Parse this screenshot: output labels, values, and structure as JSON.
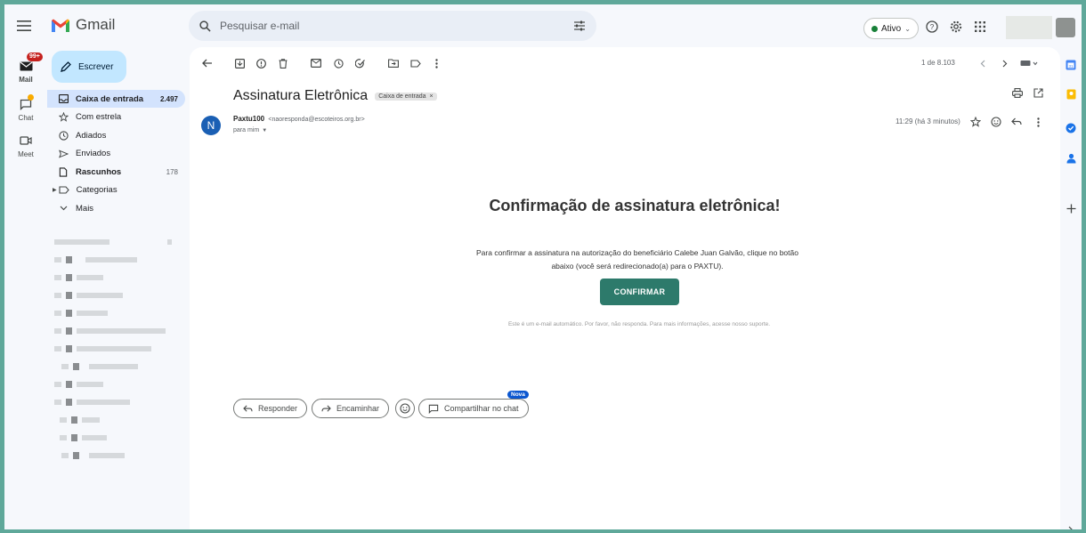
{
  "app": {
    "name": "Gmail"
  },
  "search": {
    "placeholder": "Pesquisar e-mail"
  },
  "status": {
    "label": "Ativo",
    "color": "#188038"
  },
  "rail": {
    "mail": {
      "label": "Mail",
      "badge": "99+"
    },
    "chat": {
      "label": "Chat"
    },
    "meet": {
      "label": "Meet"
    }
  },
  "compose": {
    "label": "Escrever"
  },
  "nav": [
    {
      "label": "Caixa de entrada",
      "count": "2.497",
      "icon": "inbox-icon"
    },
    {
      "label": "Com estrela",
      "count": "",
      "icon": "star-icon"
    },
    {
      "label": "Adiados",
      "count": "",
      "icon": "clock-icon"
    },
    {
      "label": "Enviados",
      "count": "",
      "icon": "send-icon"
    },
    {
      "label": "Rascunhos",
      "count": "178",
      "icon": "draft-icon"
    },
    {
      "label": "Categorias",
      "count": "",
      "icon": "label-icon"
    },
    {
      "label": "Mais",
      "count": "",
      "icon": "chevron-down-icon"
    }
  ],
  "toolbar": {
    "pager": "1 de 8.103"
  },
  "email": {
    "subject": "Assinatura Eletrônica",
    "label_chip": "Caixa de entrada",
    "label_close": "×",
    "avatar_letter": "N",
    "sender_name": "Paxtu100",
    "sender_email": "<naoresponda@escoteiros.org.br>",
    "to": "para mim",
    "time": "11:29 (há 3 minutos)",
    "body": {
      "heading": "Confirmação de assinatura eletrônica!",
      "text_line1": "Para confirmar a assinatura na autorização do beneficiário Calebe Juan Galvão, clique no botão",
      "text_line2": "abaixo (você será redirecionado(a) para o PAXTU).",
      "button": "CONFIRMAR",
      "footer": "Este é um e-mail automático. Por favor, não responda. Para mais informações, acesse nosso suporte."
    }
  },
  "actions": {
    "reply": "Responder",
    "forward": "Encaminhar",
    "share": "Compartilhar no chat",
    "new_badge": "Nova"
  },
  "colors": {
    "accent_button": "#2d7a6b",
    "active_nav": "#d3e3fd",
    "compose": "#c2e7ff"
  }
}
